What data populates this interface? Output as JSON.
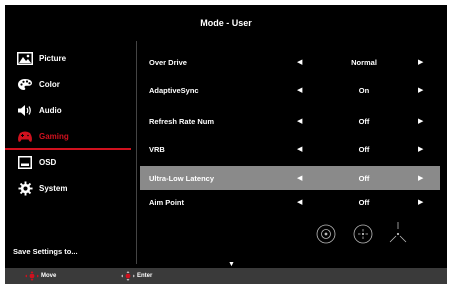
{
  "header": {
    "title": "Mode - User"
  },
  "sidebar": {
    "items": [
      {
        "label": "Picture",
        "icon": "picture-icon"
      },
      {
        "label": "Color",
        "icon": "palette-icon"
      },
      {
        "label": "Audio",
        "icon": "speaker-icon"
      },
      {
        "label": "Gaming",
        "icon": "gamepad-icon",
        "active": true
      },
      {
        "label": "OSD",
        "icon": "osd-icon"
      },
      {
        "label": "System",
        "icon": "gear-icon"
      }
    ],
    "save_label": "Save Settings to..."
  },
  "settings": [
    {
      "name": "Over Drive",
      "value": "Normal"
    },
    {
      "name": "AdaptiveSync",
      "value": "On"
    },
    {
      "name": "Refresh Rate Num",
      "value": "Off"
    },
    {
      "name": "VRB",
      "value": "Off"
    },
    {
      "name": "Ultra-Low Latency",
      "value": "Off",
      "selected": true
    },
    {
      "name": "Aim Point",
      "value": "Off"
    }
  ],
  "footer": {
    "move_label": "Move",
    "enter_label": "Enter"
  },
  "colors": {
    "accent": "#d0111e",
    "selected_row": "#8a8a8a",
    "footer_bg": "#3a3a3a"
  }
}
